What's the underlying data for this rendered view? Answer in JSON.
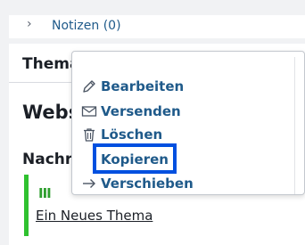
{
  "notes": {
    "label": "Notizen (0)",
    "icon": "chevron-right-icon"
  },
  "headings": {
    "theme": "Thema",
    "website": "Websi",
    "news": "Nachr"
  },
  "topic": {
    "icon": "bars-icon",
    "title": "Ein Neues Thema",
    "accent_color": "#2fc12f"
  },
  "context_menu": {
    "items": [
      {
        "label": "Bearbeiten",
        "icon": "pencil-icon"
      },
      {
        "label": "Versenden",
        "icon": "envelope-icon"
      },
      {
        "label": "Löschen",
        "icon": "trash-icon"
      },
      {
        "label": "Kopieren",
        "icon": ""
      },
      {
        "label": "Verschieben",
        "icon": "arrow-right-icon"
      }
    ],
    "focused_item": "Kopieren",
    "focus_color": "#0050e0",
    "link_color": "#1f5a8a"
  }
}
